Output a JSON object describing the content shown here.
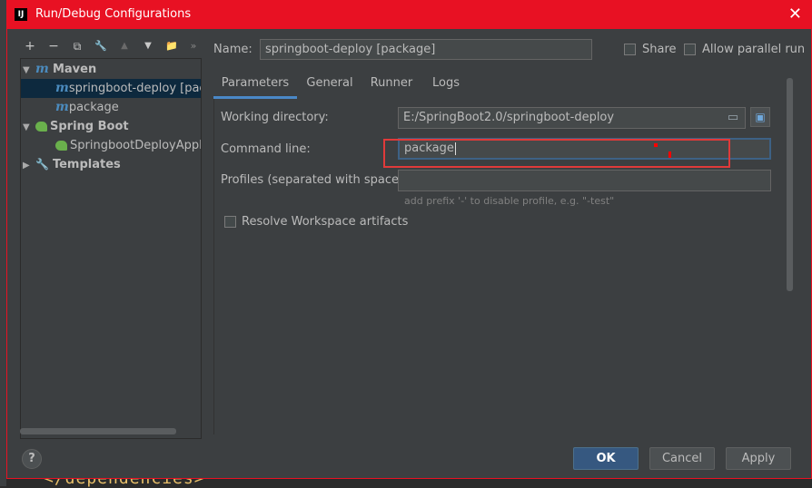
{
  "window": {
    "title": "Run/Debug Configurations",
    "logo": "IJ",
    "close": "✕"
  },
  "toolbar": {
    "add": "+",
    "remove": "−",
    "copy": "⧉",
    "edit": "🔧",
    "move_up": "▲",
    "move_down": "▼",
    "folder": "📁",
    "more": "»"
  },
  "tree": {
    "maven_label": "Maven",
    "maven_child_1": "springboot-deploy [package]",
    "maven_child_2": "package",
    "spring_boot_label": "Spring Boot",
    "spring_boot_child_1": "SpringbootDeployApplication",
    "templates_label": "Templates"
  },
  "name_field": {
    "label": "Name:",
    "value": "springboot-deploy [package]"
  },
  "options": {
    "share_label": "Share",
    "parallel_label": "Allow parallel run"
  },
  "tabs": [
    "Parameters",
    "General",
    "Runner",
    "Logs"
  ],
  "form": {
    "working_dir_label": "Working directory:",
    "working_dir_value": "E:/SpringBoot2.0/springboot-deploy",
    "command_line_label": "Command line:",
    "command_line_value": "package",
    "profiles_label": "Profiles (separated with space):",
    "profiles_value": "",
    "profiles_hint": "add prefix '-' to disable profile, e.g. \"-test\"",
    "resolve_label": "Resolve Workspace artifacts"
  },
  "buttons": {
    "help": "?",
    "ok": "OK",
    "cancel": "Cancel",
    "apply": "Apply"
  },
  "background": {
    "editor_text": "</dependencies>"
  },
  "colors": {
    "titlebar": "#e81123",
    "dialog_bg": "#3c3f41",
    "selection": "#0d293e",
    "accent": "#4a88c7",
    "ok_button": "#365880",
    "highlight_box": "#e03a3a"
  }
}
